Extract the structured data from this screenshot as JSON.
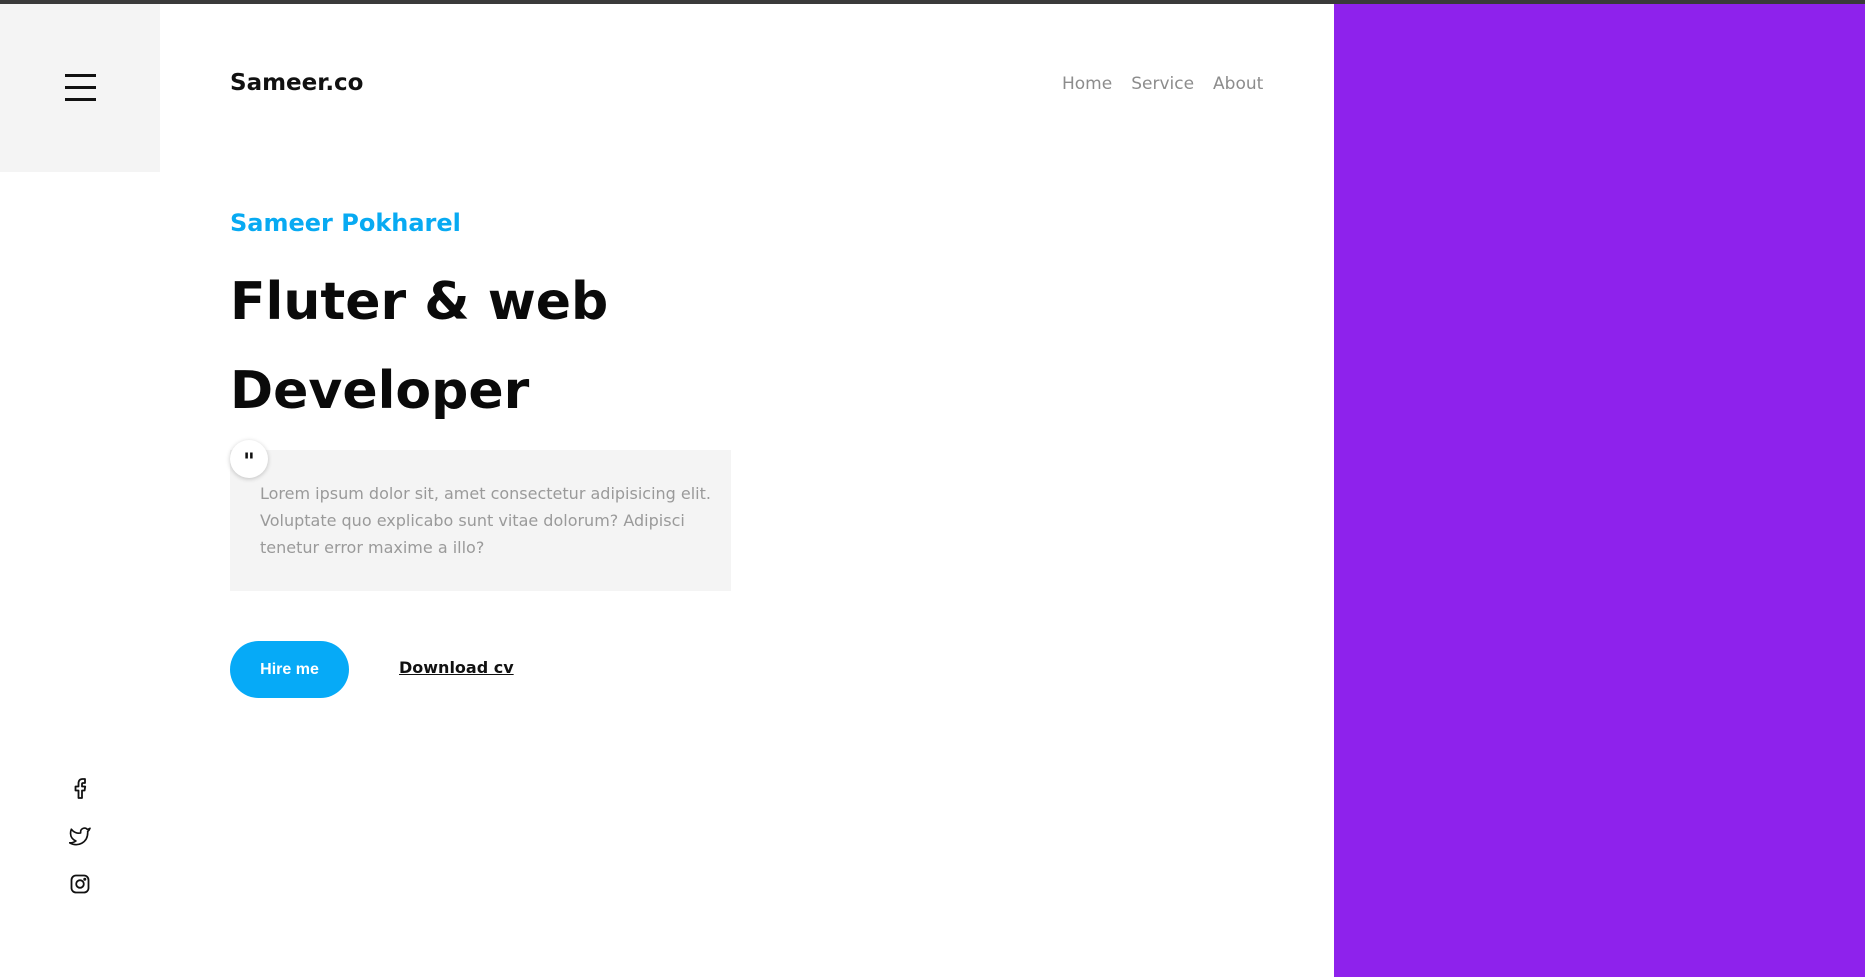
{
  "header": {
    "brand": "Sameer.co",
    "nav": [
      "Home",
      "Service",
      "About"
    ]
  },
  "hero": {
    "name": "Sameer Pokharel",
    "title_line1": "Fluter & web",
    "title_line2": "Developer",
    "quote_mark": "\"",
    "quote": "Lorem ipsum dolor sit, amet consectetur adipisicing elit. Voluptate quo explicabo sunt vitae dolorum? Adipisci tenetur error maxime a illo?",
    "hire_label": "Hire me",
    "download_label": "Download cv"
  },
  "social": {
    "icons": [
      "facebook-icon",
      "twitter-icon",
      "instagram-icon"
    ]
  },
  "colors": {
    "accent": "#06aaf7",
    "panel": "#8e22ec",
    "menu_bg": "#f4f4f4"
  },
  "icons": {
    "menu": "hamburger-menu-icon"
  }
}
